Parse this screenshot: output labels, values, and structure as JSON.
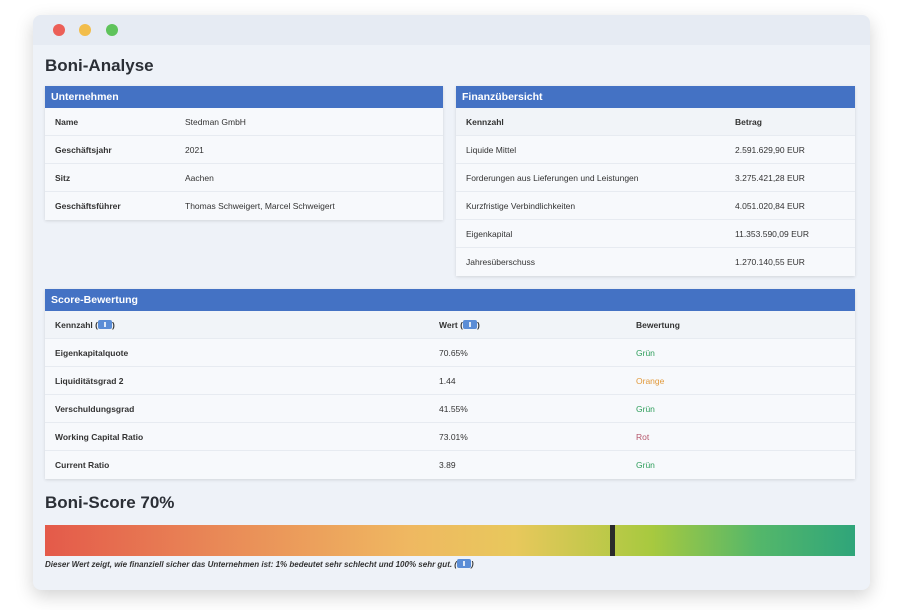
{
  "window": {
    "controls": [
      "close",
      "minimize",
      "maximize"
    ]
  },
  "page": {
    "title": "Boni-Analyse"
  },
  "company": {
    "header": "Unternehmen",
    "rows": [
      {
        "label": "Name",
        "value": "Stedman GmbH"
      },
      {
        "label": "Geschäftsjahr",
        "value": "2021"
      },
      {
        "label": "Sitz",
        "value": "Aachen"
      },
      {
        "label": "Geschäftsführer",
        "value": "Thomas Schweigert, Marcel Schweigert"
      }
    ]
  },
  "finance": {
    "header": "Finanzübersicht",
    "columns": [
      "Kennzahl",
      "Betrag"
    ],
    "rows": [
      {
        "label": "Liquide Mittel",
        "value": "2.591.629,90 EUR"
      },
      {
        "label": "Forderungen aus Lieferungen und Leistungen",
        "value": "3.275.421,28 EUR"
      },
      {
        "label": "Kurzfristige Verbindlichkeiten",
        "value": "4.051.020,84 EUR"
      },
      {
        "label": "Eigenkapital",
        "value": "11.353.590,09 EUR"
      },
      {
        "label": "Jahresüberschuss",
        "value": "1.270.140,55 EUR"
      }
    ]
  },
  "score_table": {
    "header": "Score-Bewertung",
    "columns": [
      "Kennzahl (",
      ")",
      "Wert (",
      ")",
      "Bewertung"
    ],
    "rows": [
      {
        "label": "Eigenkapitalquote",
        "value": "70.65%",
        "rating": "Grün",
        "rating_color": "#2e9e5b"
      },
      {
        "label": "Liquiditätsgrad 2",
        "value": "1.44",
        "rating": "Orange",
        "rating_color": "#e29a3b"
      },
      {
        "label": "Verschuldungsgrad",
        "value": "41.55%",
        "rating": "Grün",
        "rating_color": "#2e9e5b"
      },
      {
        "label": "Working Capital Ratio",
        "value": "73.01%",
        "rating": "Rot",
        "rating_color": "#b5566b"
      },
      {
        "label": "Current Ratio",
        "value": "3.89",
        "rating": "Grün",
        "rating_color": "#2e9e5b"
      }
    ]
  },
  "boni_score": {
    "title": "Boni-Score 70%",
    "value_percent": 70,
    "note": "Dieser Wert zeigt, wie finanziell sicher das Unternehmen ist: 1% bedeutet sehr schlecht und 100% sehr gut. ("
  },
  "colors": {
    "accent": "#4472c4",
    "background": "#eef2f8"
  }
}
